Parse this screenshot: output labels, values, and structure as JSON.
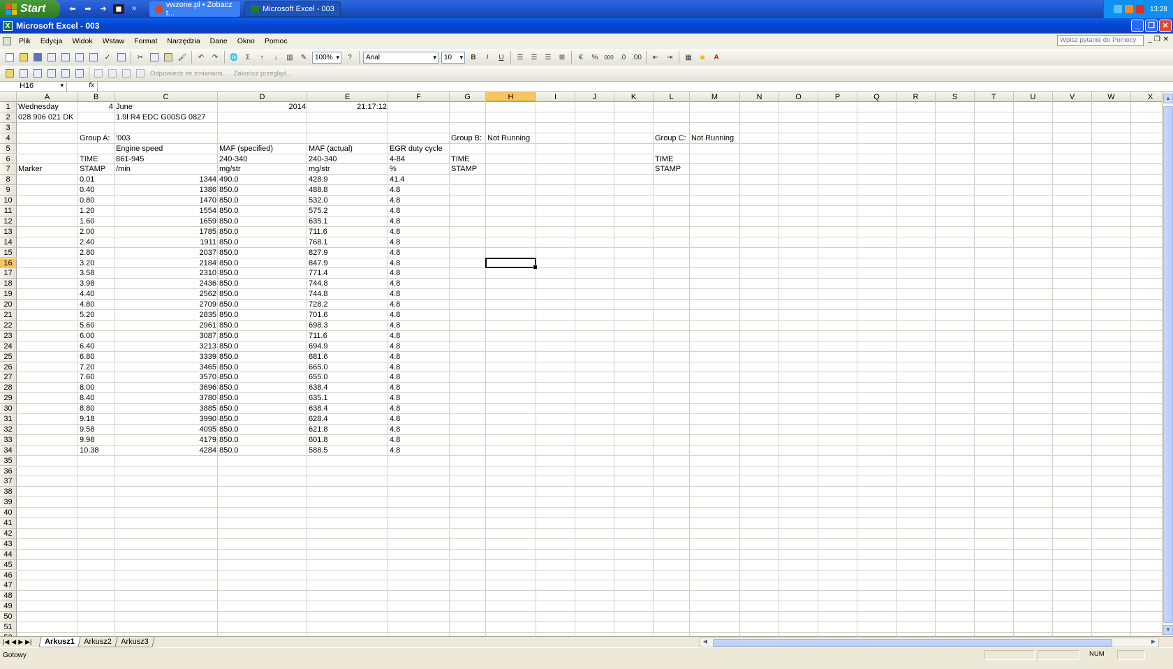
{
  "taskbar": {
    "start_label": "Start",
    "tasks": [
      {
        "label": "vwzone.pl • Zobacz t...",
        "color": "#d9442b"
      },
      {
        "label": "Microsoft Excel - 003",
        "color": "#1d7a3a"
      }
    ],
    "clock": "13:28"
  },
  "window": {
    "title": "Microsoft Excel - 003"
  },
  "menu": {
    "items": [
      "Plik",
      "Edycja",
      "Widok",
      "Wstaw",
      "Format",
      "Narzędzia",
      "Dane",
      "Okno",
      "Pomoc"
    ],
    "help_placeholder": "Wpisz pytanie do Pomocy"
  },
  "toolbar": {
    "zoom": "100%",
    "font_name": "Arial",
    "font_size": "10",
    "bold": "B",
    "italic": "I",
    "underline": "U",
    "percent": "%",
    "thousands": "000",
    "review_reply": "Odpowiedz ze zmianami...",
    "review_end": "Zakończ przegląd..."
  },
  "formula_bar": {
    "cell_ref": "H16",
    "fx": "fx",
    "value": ""
  },
  "sheet": {
    "columns": [
      "A",
      "B",
      "C",
      "D",
      "E",
      "F",
      "G",
      "H",
      "I",
      "J",
      "K",
      "L",
      "M",
      "N",
      "O",
      "P",
      "Q",
      "R",
      "S",
      "T",
      "U",
      "V",
      "W",
      "X"
    ],
    "selected_column": "H",
    "selected_row": 16,
    "row_count": 52,
    "cells": {
      "r1": {
        "A": "Wednesday",
        "B": "4",
        "C": "June",
        "D": "2014",
        "E": "21:17:12"
      },
      "r2": {
        "A": "028 906 021 DK",
        "C": "1.9l R4 EDC  G00SG  0827"
      },
      "r4": {
        "B": "Group A:",
        "C": "'003",
        "G": "Group B:",
        "H": "Not Running",
        "L": "Group C:",
        "M": "Not Running"
      },
      "r5": {
        "C": "Engine speed",
        "D": "MAF (specified)",
        "E": "MAF (actual)",
        "F": "EGR duty cycle"
      },
      "r6": {
        "B": "TIME",
        "C": "861-945",
        "D": "240-340",
        "E": "240-340",
        "F": "4-84",
        "G": "TIME",
        "L": "TIME"
      },
      "r7": {
        "A": "Marker",
        "B": "STAMP",
        "C": " /min",
        "D": " mg/str",
        "E": " mg/str",
        "F": " %",
        "G": "STAMP",
        "L": "STAMP"
      }
    },
    "data_rows": [
      {
        "time": "0.01",
        "rpm": "1344",
        "maf_spec": "490.0",
        "maf_act": "428.9",
        "egr": "41.4"
      },
      {
        "time": "0.40",
        "rpm": "1386",
        "maf_spec": "850.0",
        "maf_act": "488.8",
        "egr": "4.8"
      },
      {
        "time": "0.80",
        "rpm": "1470",
        "maf_spec": "850.0",
        "maf_act": "532.0",
        "egr": "4.8"
      },
      {
        "time": "1.20",
        "rpm": "1554",
        "maf_spec": "850.0",
        "maf_act": "575.2",
        "egr": "4.8"
      },
      {
        "time": "1.60",
        "rpm": "1659",
        "maf_spec": "850.0",
        "maf_act": "635.1",
        "egr": "4.8"
      },
      {
        "time": "2.00",
        "rpm": "1785",
        "maf_spec": "850.0",
        "maf_act": "711.6",
        "egr": "4.8"
      },
      {
        "time": "2.40",
        "rpm": "1911",
        "maf_spec": "850.0",
        "maf_act": "768.1",
        "egr": "4.8"
      },
      {
        "time": "2.80",
        "rpm": "2037",
        "maf_spec": "850.0",
        "maf_act": "827.9",
        "egr": "4.8"
      },
      {
        "time": "3.20",
        "rpm": "2184",
        "maf_spec": "850.0",
        "maf_act": "847.9",
        "egr": "4.8"
      },
      {
        "time": "3.58",
        "rpm": "2310",
        "maf_spec": "850.0",
        "maf_act": "771.4",
        "egr": "4.8"
      },
      {
        "time": "3.98",
        "rpm": "2436",
        "maf_spec": "850.0",
        "maf_act": "744.8",
        "egr": "4.8"
      },
      {
        "time": "4.40",
        "rpm": "2562",
        "maf_spec": "850.0",
        "maf_act": "744.8",
        "egr": "4.8"
      },
      {
        "time": "4.80",
        "rpm": "2709",
        "maf_spec": "850.0",
        "maf_act": "728.2",
        "egr": "4.8"
      },
      {
        "time": "5.20",
        "rpm": "2835",
        "maf_spec": "850.0",
        "maf_act": "701.6",
        "egr": "4.8"
      },
      {
        "time": "5.60",
        "rpm": "2961",
        "maf_spec": "850.0",
        "maf_act": "698.3",
        "egr": "4.8"
      },
      {
        "time": "6.00",
        "rpm": "3087",
        "maf_spec": "850.0",
        "maf_act": "711.6",
        "egr": "4.8"
      },
      {
        "time": "6.40",
        "rpm": "3213",
        "maf_spec": "850.0",
        "maf_act": "694.9",
        "egr": "4.8"
      },
      {
        "time": "6.80",
        "rpm": "3339",
        "maf_spec": "850.0",
        "maf_act": "681.6",
        "egr": "4.8"
      },
      {
        "time": "7.20",
        "rpm": "3465",
        "maf_spec": "850.0",
        "maf_act": "665.0",
        "egr": "4.8"
      },
      {
        "time": "7.60",
        "rpm": "3570",
        "maf_spec": "850.0",
        "maf_act": "655.0",
        "egr": "4.8"
      },
      {
        "time": "8.00",
        "rpm": "3696",
        "maf_spec": "850.0",
        "maf_act": "638.4",
        "egr": "4.8"
      },
      {
        "time": "8.40",
        "rpm": "3780",
        "maf_spec": "850.0",
        "maf_act": "635.1",
        "egr": "4.8"
      },
      {
        "time": "8.80",
        "rpm": "3885",
        "maf_spec": "850.0",
        "maf_act": "638.4",
        "egr": "4.8"
      },
      {
        "time": "9.18",
        "rpm": "3990",
        "maf_spec": "850.0",
        "maf_act": "628.4",
        "egr": "4.8"
      },
      {
        "time": "9.58",
        "rpm": "4095",
        "maf_spec": "850.0",
        "maf_act": "621.8",
        "egr": "4.8"
      },
      {
        "time": "9.98",
        "rpm": "4179",
        "maf_spec": "850.0",
        "maf_act": "601.8",
        "egr": "4.8"
      },
      {
        "time": "10.38",
        "rpm": "4284",
        "maf_spec": "850.0",
        "maf_act": "588.5",
        "egr": "4.8"
      }
    ]
  },
  "sheet_tabs": [
    "Arkusz1",
    "Arkusz2",
    "Arkusz3"
  ],
  "active_tab": "Arkusz1",
  "status": {
    "ready": "Gotowy",
    "num": "NUM"
  }
}
